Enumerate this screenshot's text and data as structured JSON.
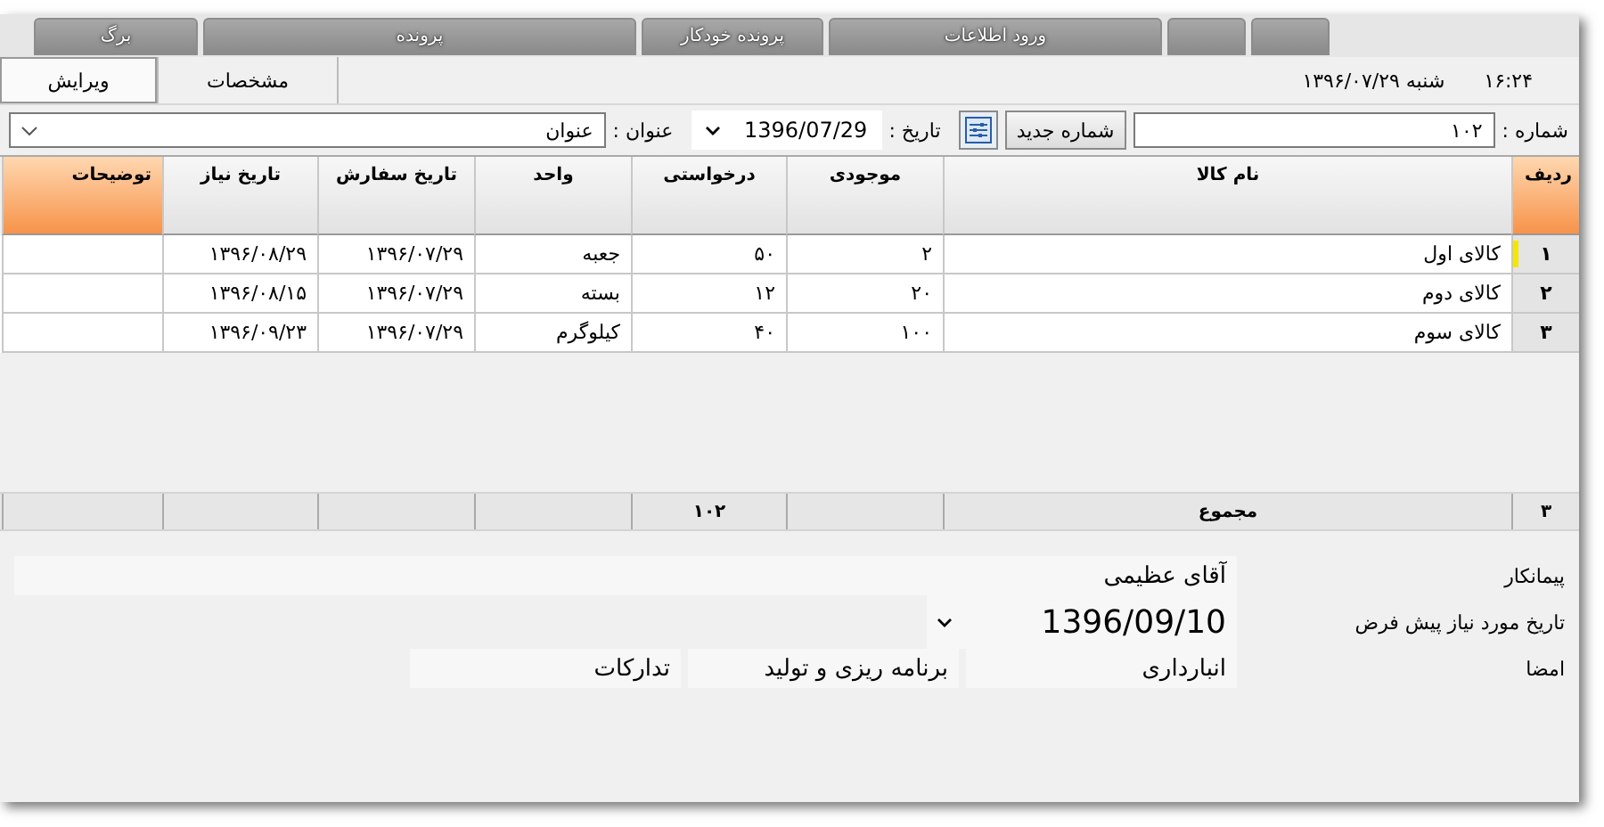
{
  "menu_tabs": [
    {
      "kind": "blank"
    },
    {
      "kind": "blank"
    },
    {
      "kind": "text",
      "label": "ورود اطلاعات"
    },
    {
      "kind": "text",
      "label": "پرونده خودکار"
    },
    {
      "kind": "text",
      "label": "پرونده"
    },
    {
      "kind": "text",
      "label": "برگ"
    }
  ],
  "clock": "۱۶:۲۴",
  "date_line": "شنبه  ۱۳۹۶/۰۷/۲۹",
  "view_tabs": [
    {
      "label": "مشخصات",
      "selected": false
    },
    {
      "label": "ویرایش",
      "selected": true
    }
  ],
  "form": {
    "number_label": "شماره :",
    "number": "۱۰۲",
    "new_number_button": "شماره جدید",
    "date_label": "تاریخ :",
    "date": "1396/07/29",
    "title_label": "عنوان :",
    "title": "عنوان"
  },
  "table": {
    "columns": [
      {
        "label": "ردیف",
        "kind": "index"
      },
      {
        "label": "نام کالا",
        "kind": "plain"
      },
      {
        "label": "موجودی",
        "kind": "plain"
      },
      {
        "label": "درخواستی",
        "kind": "plain"
      },
      {
        "label": "واحد",
        "kind": "plain"
      },
      {
        "label": "تاریخ سفارش",
        "kind": "plain"
      },
      {
        "label": "تاریخ نیاز",
        "kind": "plain"
      },
      {
        "label": "توضیحات",
        "kind": "accent"
      }
    ],
    "rows": [
      {
        "current": true,
        "cells": [
          "۱",
          "کالای اول",
          "۲",
          "۵۰",
          "جعبه",
          "۱۳۹۶/۰۷/۲۹",
          "۱۳۹۶/۰۸/۲۹"
        ]
      },
      {
        "current": false,
        "cells": [
          "۲",
          "کالای دوم",
          "۲۰",
          "۱۲",
          "بسته",
          "۱۳۹۶/۰۷/۲۹",
          "۱۳۹۶/۰۸/۱۵"
        ]
      },
      {
        "current": false,
        "cells": [
          "۳",
          "کالای سوم",
          "۱۰۰",
          "۴۰",
          "کیلوگرم",
          "۱۳۹۶/۰۷/۲۹",
          "۱۳۹۶/۰۹/۲۳"
        ]
      }
    ],
    "footer": {
      "row_count": "۳",
      "label": "مجموع",
      "requested_total": "۱۰۲"
    }
  },
  "contractor_label": "پیمانکار",
  "contractor": "آقای عظیمی",
  "default_date_label": "تاریخ مورد نیاز پیش فرض",
  "default_date": "1396/09/10",
  "signature_label": "امضا",
  "signatures": [
    "انبارداری",
    "برنامه ریزی و تولید",
    "تدارکات"
  ]
}
